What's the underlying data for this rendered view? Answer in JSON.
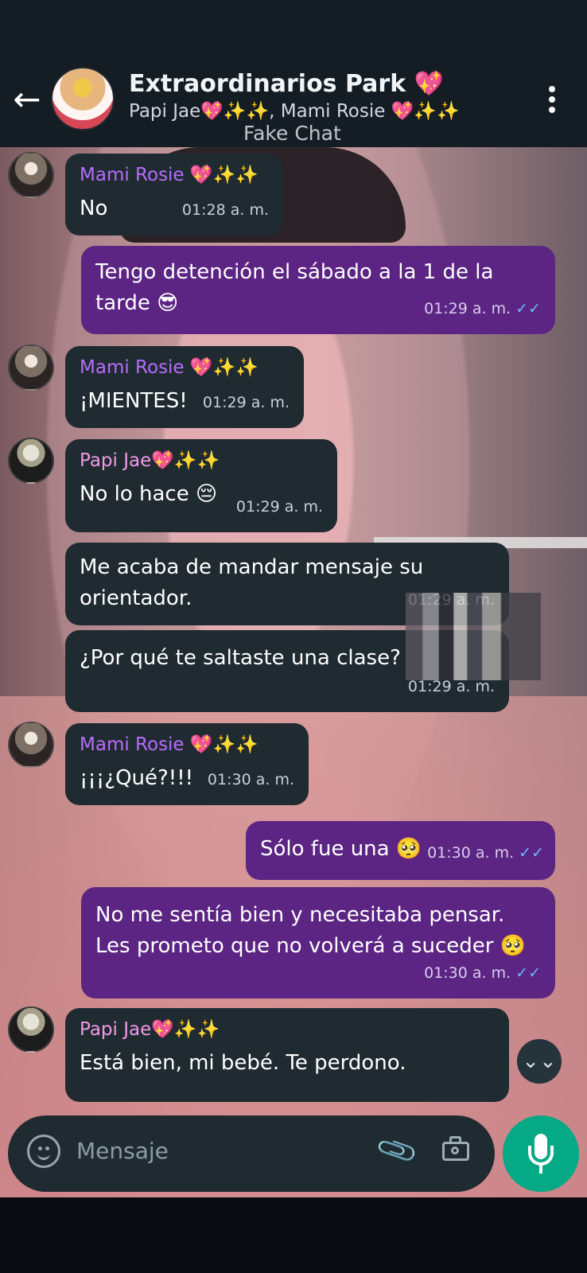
{
  "header": {
    "back_label": "←",
    "title": "Extraordinarios Park 💖",
    "members": "Papi Jae💖✨✨, Mami Rosie 💖✨✨",
    "subtitle": "Fake Chat",
    "menu_label": "⋮"
  },
  "messages": [
    {
      "direction": "incoming",
      "sender": "Mami Rosie 💖✨✨",
      "text": "No",
      "time": "01:28 a. m."
    },
    {
      "direction": "outgoing",
      "text": "Tengo detención el sábado a la 1 de la tarde 😎",
      "time": "01:29 a. m.",
      "status": "✓✓"
    },
    {
      "direction": "incoming",
      "sender": "Mami Rosie 💖✨✨",
      "text": "¡MIENTES!",
      "time": "01:29 a. m."
    },
    {
      "direction": "incoming",
      "sender": "Papi Jae💖✨✨",
      "text": "No lo hace 😔",
      "time": "01:29 a. m."
    },
    {
      "direction": "incoming",
      "text": "Me acaba de mandar mensaje su orientador.",
      "time": "01:29 a. m."
    },
    {
      "direction": "incoming",
      "text": "¿Por qué te saltaste una clase?",
      "time": "01:29 a. m."
    },
    {
      "direction": "incoming",
      "sender": "Mami Rosie 💖✨✨",
      "text": "¡¡¡¿Qué?!!!",
      "time": "01:30 a. m."
    },
    {
      "direction": "outgoing",
      "text": "Sólo fue una 🥺",
      "time": "01:30 a. m.",
      "status": "✓✓"
    },
    {
      "direction": "outgoing",
      "text": "No me sentía bien y necesitaba pensar. Les prometo que no volverá a suceder 🥺",
      "time": "01:30 a. m.",
      "status": "✓✓"
    },
    {
      "direction": "incoming",
      "sender": "Papi Jae💖✨✨",
      "text": "Está bien, mi bebé. Te perdono."
    }
  ],
  "composer": {
    "placeholder": "Mensaje",
    "scroll_label": "⌄⌄",
    "attach_label": "📎"
  },
  "colors": {
    "header": "#141d24",
    "incoming": "#1f2b31",
    "outgoing": "#5c2584",
    "accent": "#05a985"
  }
}
